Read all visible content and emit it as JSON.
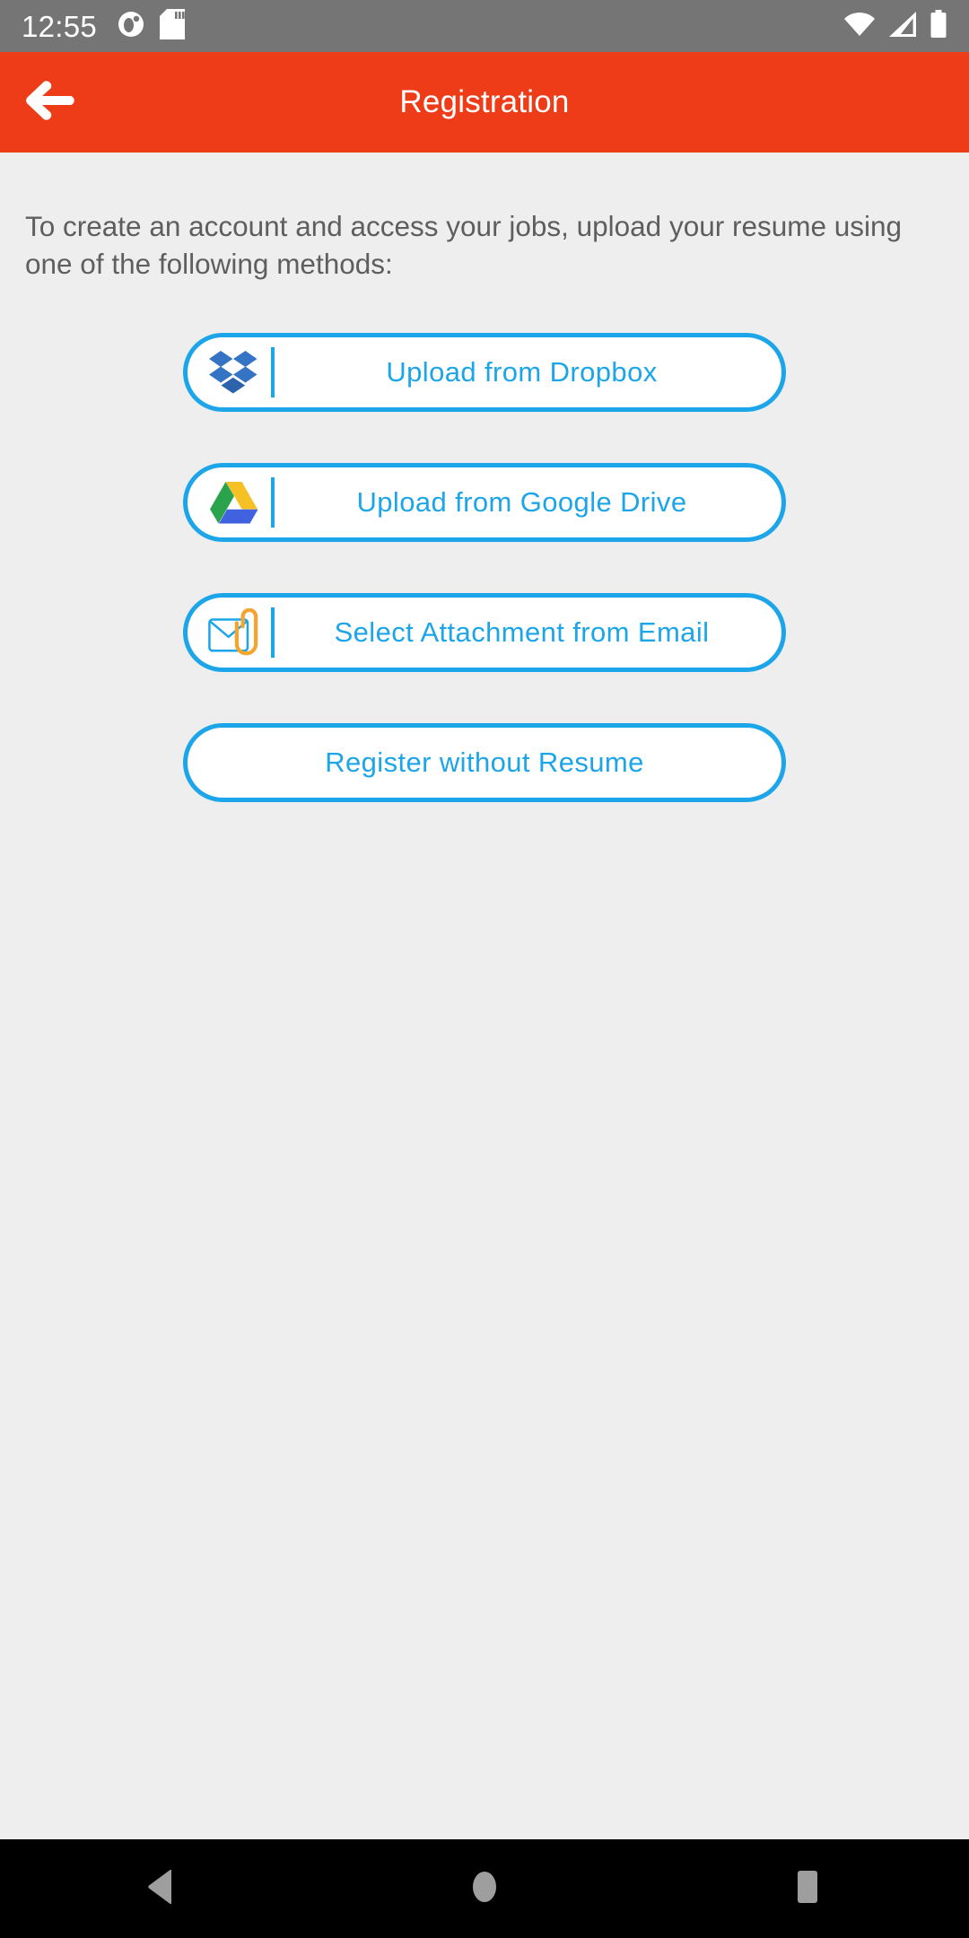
{
  "status_bar": {
    "time": "12:55",
    "background": "#757575",
    "left_icons": [
      "alarm-clock-icon",
      "sd-card-icon"
    ],
    "right_icons": [
      "wifi-icon",
      "cellular-signal-icon",
      "battery-icon"
    ]
  },
  "app_bar": {
    "title": "Registration",
    "background": "#EE3B18",
    "back_icon": "back-arrow-icon"
  },
  "main": {
    "intro": "To create an account and access your jobs, upload your resume using one of the following methods:",
    "accent": "#1CA5E8",
    "background": "#EEEEEE",
    "buttons": [
      {
        "label": "Upload from Dropbox",
        "icon": "dropbox-icon",
        "has_icon": true
      },
      {
        "label": "Upload from Google Drive",
        "icon": "google-drive-icon",
        "has_icon": true
      },
      {
        "label": "Select Attachment from Email",
        "icon": "email-attachment-icon",
        "has_icon": true
      },
      {
        "label": "Register without Resume",
        "icon": "",
        "has_icon": false
      }
    ]
  },
  "nav_bar": {
    "background": "#000000",
    "glyph_color": "#9E9E9E",
    "items": [
      "back-triangle-icon",
      "home-circle-icon",
      "recents-square-icon"
    ]
  }
}
